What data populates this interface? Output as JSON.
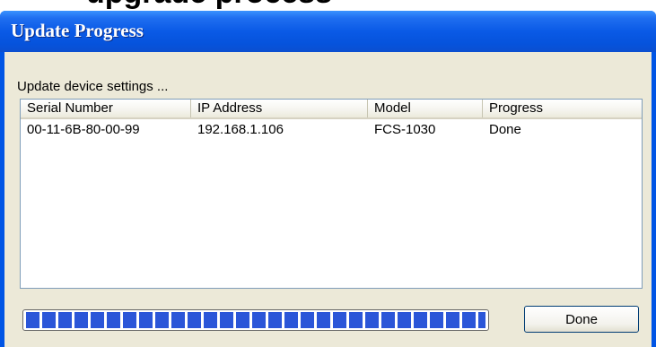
{
  "page_heading": "upgrade process",
  "dialog": {
    "title": "Update Progress",
    "status_text": "Update device settings ...",
    "columns": [
      "Serial Number",
      "IP Address",
      "Model",
      "Progress"
    ],
    "rows": [
      [
        "00-11-6B-80-00-99",
        "192.168.1.106",
        "FCS-1030",
        "Done"
      ]
    ],
    "progress_percent": 100,
    "done_button": "Done"
  },
  "colors": {
    "titlebar": "#0a5ae6",
    "progress_fill": "#2b56d8",
    "dialog_background": "#ece9d8"
  }
}
